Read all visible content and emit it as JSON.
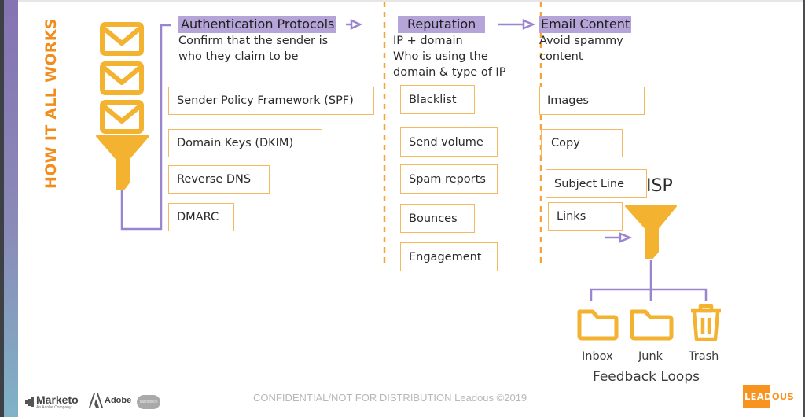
{
  "slide": {
    "vertical_title": "HOW IT ALL WORKS",
    "colors": {
      "accent_orange": "#f28c1b",
      "icon_yellow": "#f3b22f",
      "box_border": "#f4b860",
      "connector_purple": "#9a86cf",
      "header_highlight": "#b4a4d8"
    }
  },
  "columns": {
    "authentication": {
      "title": "Authentication Protocols",
      "subtitle_lines": [
        "Confirm that the sender is",
        "who they claim to be"
      ],
      "items": [
        "Sender Policy Framework (SPF)",
        "Domain Keys (DKIM)",
        "Reverse DNS",
        "DMARC"
      ]
    },
    "reputation": {
      "title": "Reputation",
      "subtitle_lines": [
        "IP + domain",
        "Who is using the",
        "domain & type of IP"
      ],
      "items": [
        "Blacklist",
        "Send volume",
        "Spam reports",
        "Bounces",
        "Engagement"
      ]
    },
    "email_content": {
      "title": "Email Content",
      "subtitle_lines": [
        "Avoid spammy",
        "content"
      ],
      "items": [
        "Images",
        "Copy",
        "Subject Line",
        "Links"
      ]
    }
  },
  "isp": {
    "label": "ISP",
    "destinations": [
      {
        "label": "Inbox",
        "icon": "folder-icon"
      },
      {
        "label": "Junk",
        "icon": "folder-icon"
      },
      {
        "label": "Trash",
        "icon": "trash-icon"
      }
    ],
    "feedback_label": "Feedback Loops"
  },
  "icons": {
    "email_stack": [
      "envelope-icon",
      "envelope-icon",
      "envelope-icon"
    ],
    "filter": "funnel-icon"
  },
  "footer": {
    "confidential": "CONFIDENTIAL/NOT FOR DISTRIBUTION  Leadous ©2019",
    "partner_logos": {
      "marketo": {
        "name": "Marketo",
        "tagline": "An Adobe Company"
      },
      "adobe": {
        "name": "Adobe"
      },
      "salesforce": {
        "name": "salesforce"
      }
    },
    "brand_logo": {
      "part1": "LEAD",
      "part2": "OUS"
    }
  }
}
